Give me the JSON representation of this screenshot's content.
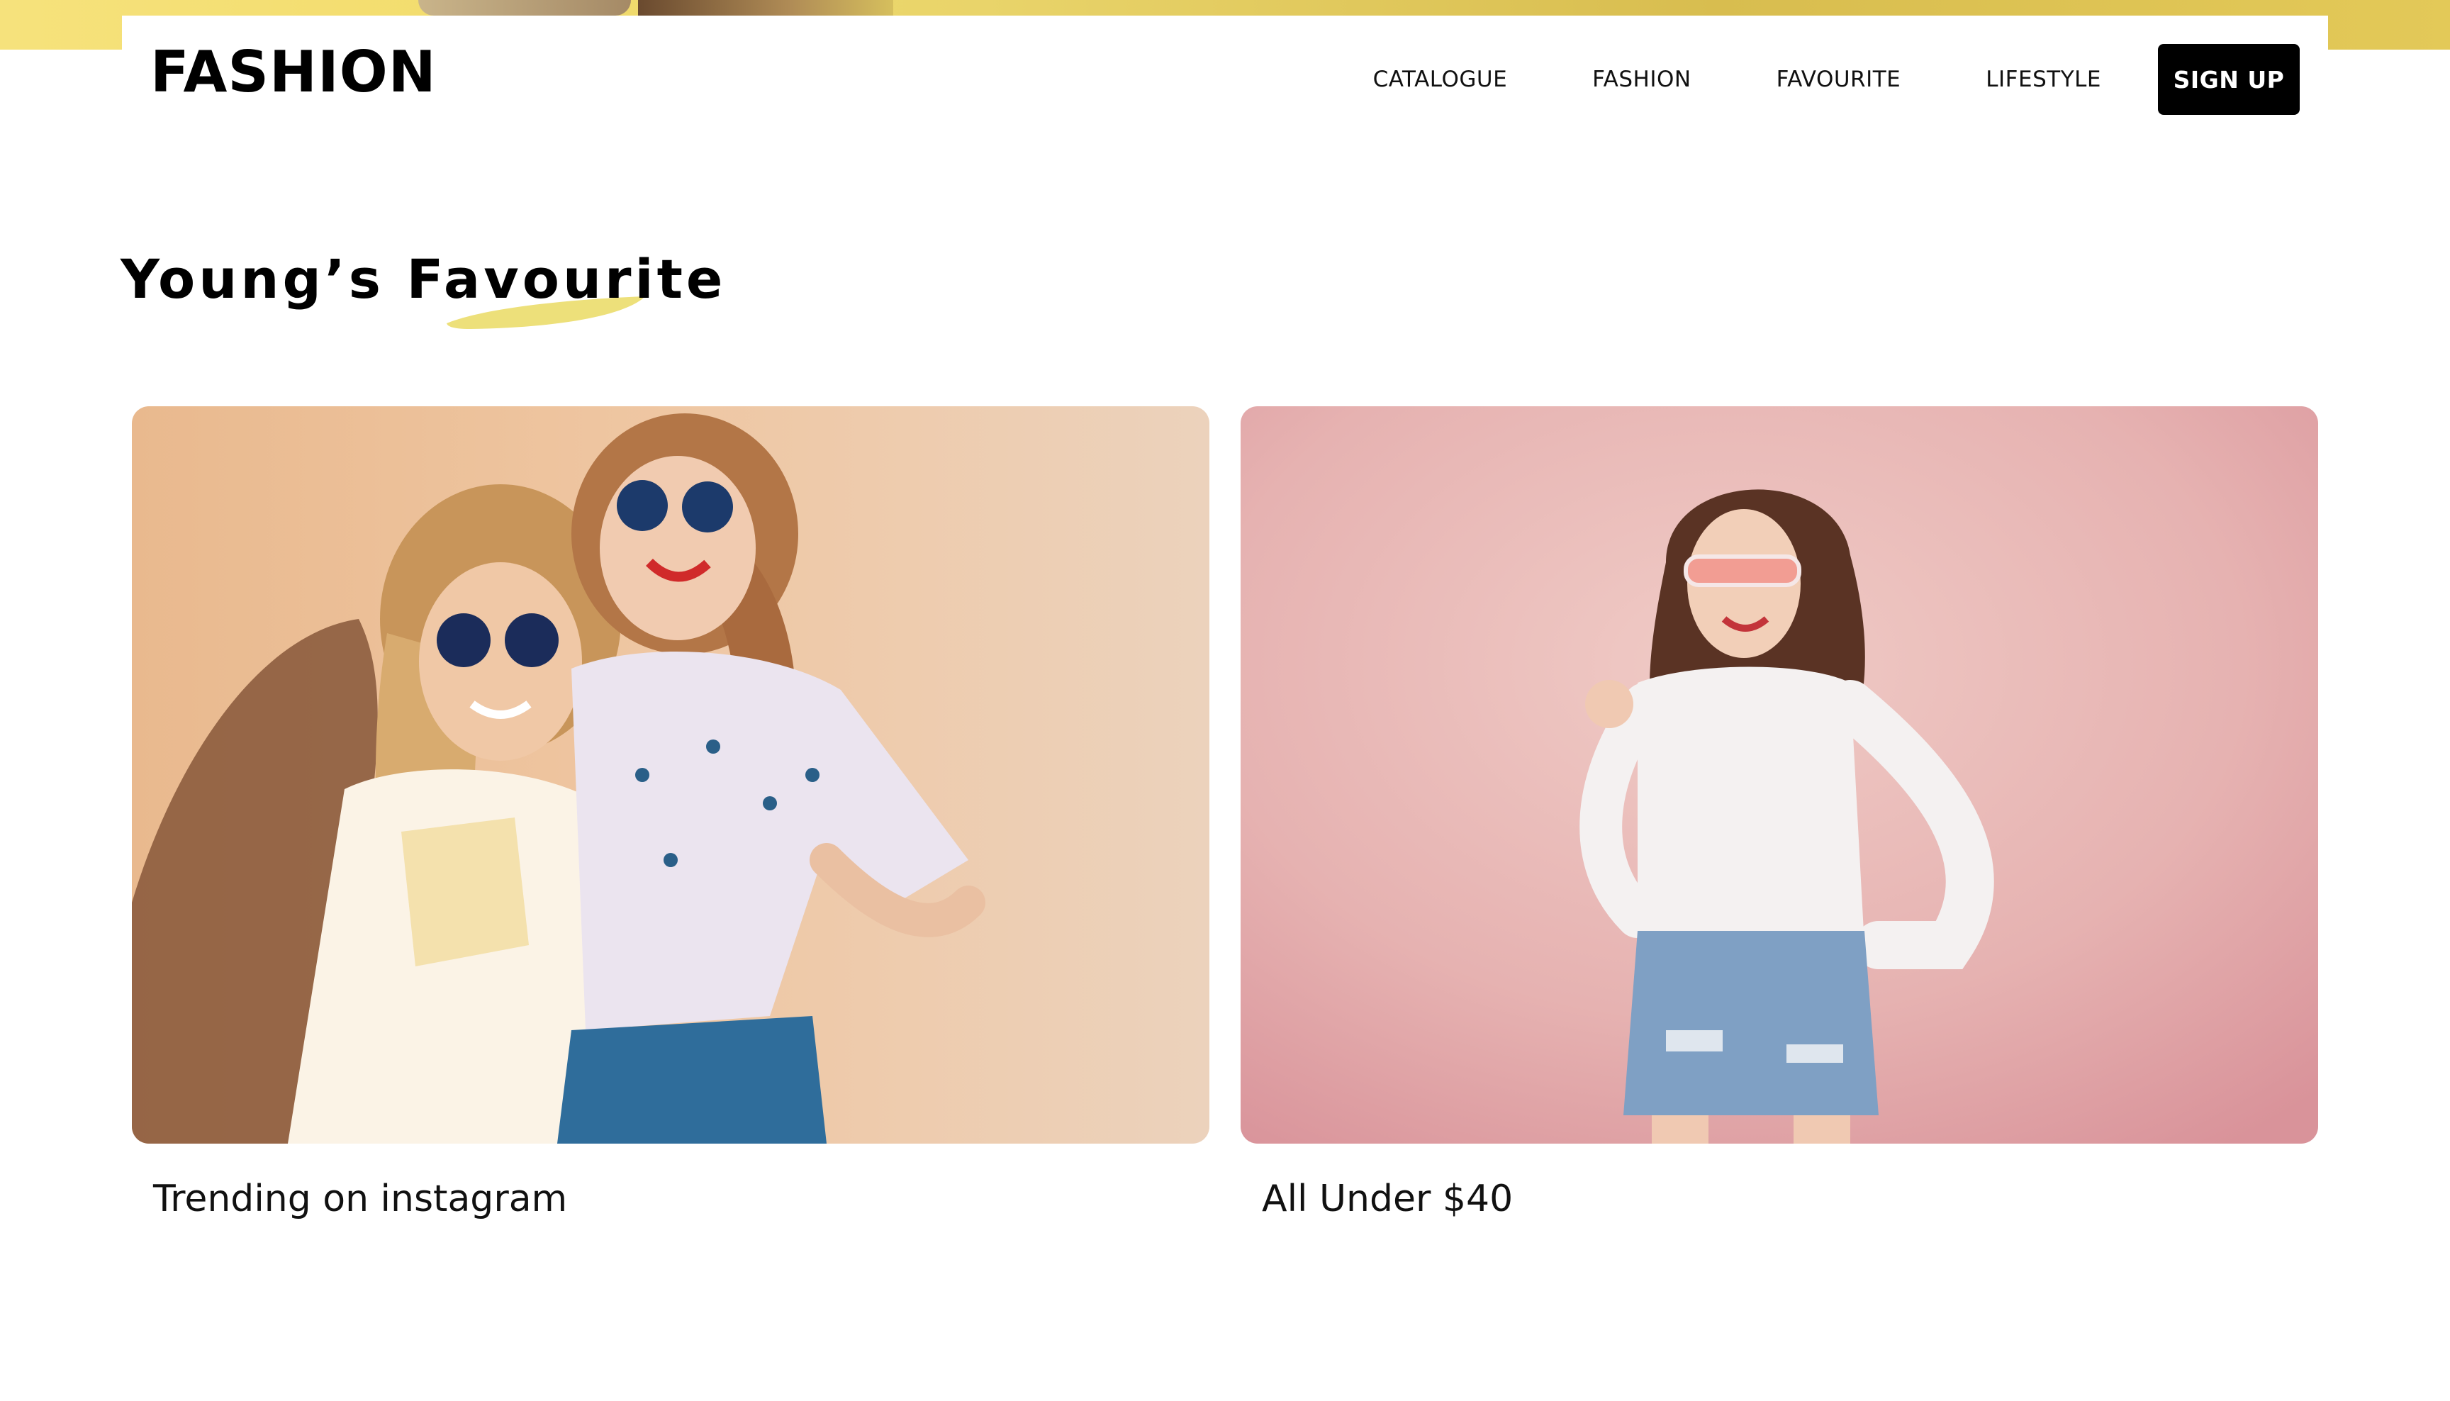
{
  "header": {
    "logo": "FASHION",
    "nav": [
      {
        "label": "CATALOGUE"
      },
      {
        "label": "FASHION"
      },
      {
        "label": "FAVOURITE"
      },
      {
        "label": "LIFESTYLE"
      }
    ],
    "signup_label": "SIGN UP"
  },
  "section": {
    "title": "Young’s Favourite",
    "accent_color": "#ede07a"
  },
  "cards": [
    {
      "caption": "Trending on instagram",
      "image": "two-women-sunglasses-photo",
      "bg_color": "#ecc7a5"
    },
    {
      "caption": "All Under $40",
      "image": "woman-pink-background-photo",
      "bg_color": "#e3aeb0"
    }
  ],
  "colors": {
    "top_strip": "#f3dd6e",
    "button_bg": "#000000",
    "button_text": "#ffffff"
  }
}
